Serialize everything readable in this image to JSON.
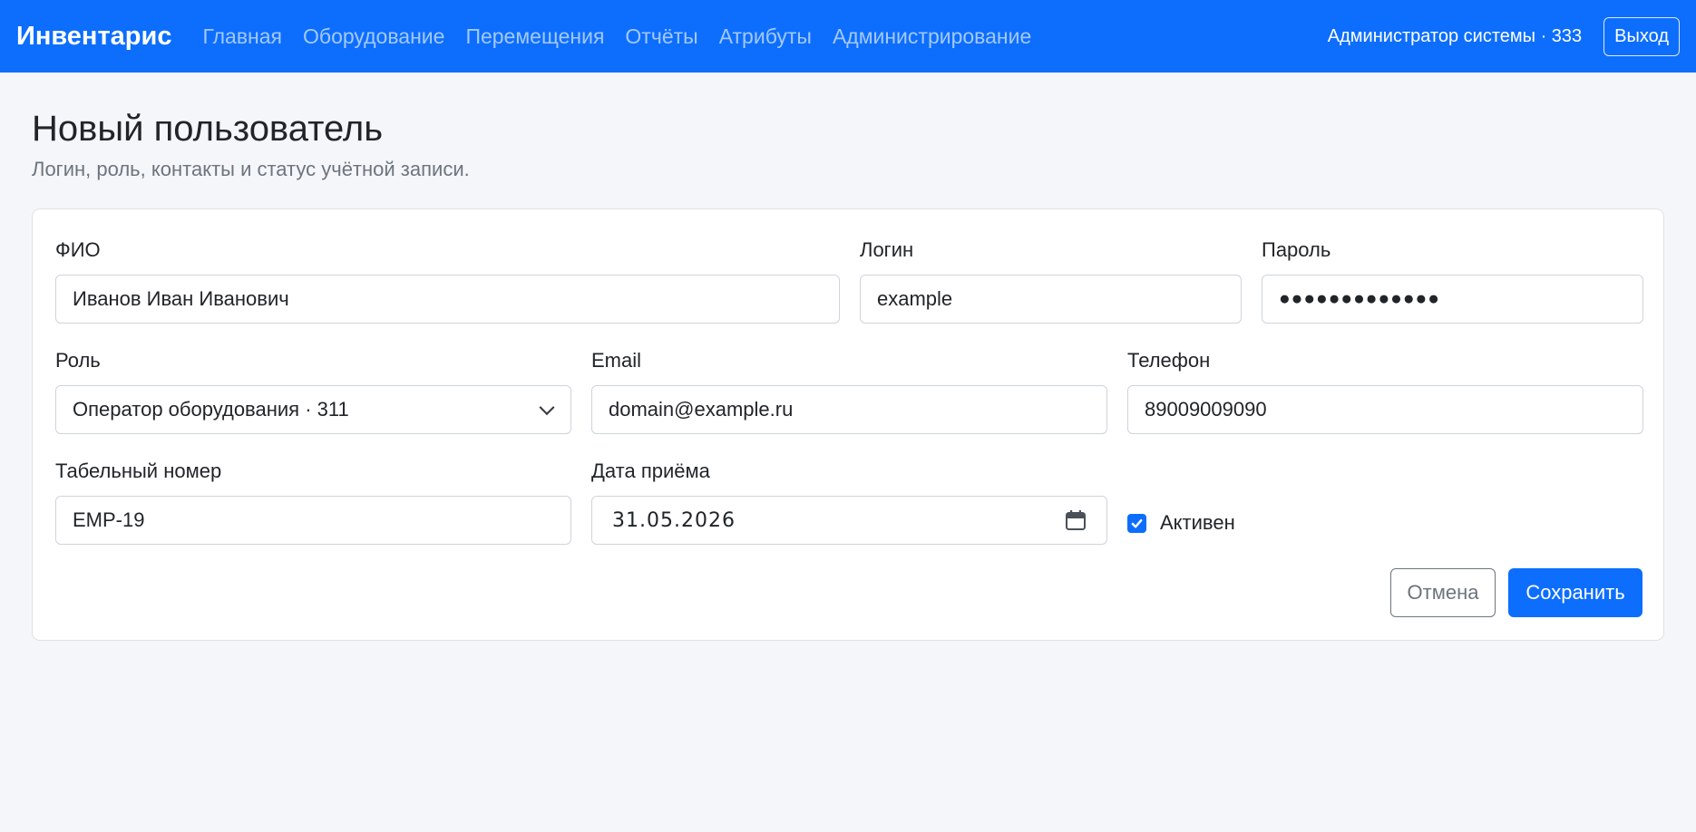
{
  "app": {
    "brand": "Инвентарис",
    "nav": [
      {
        "label": "Главная"
      },
      {
        "label": "Оборудование"
      },
      {
        "label": "Перемещения"
      },
      {
        "label": "Отчёты"
      },
      {
        "label": "Атрибуты"
      },
      {
        "label": "Администрирование"
      }
    ],
    "user": "Администратор системы · 333",
    "logout_label": "Выход"
  },
  "page": {
    "title": "Новый пользователь",
    "subtitle": "Логин, роль, контакты и статус учётной записи."
  },
  "form": {
    "full_name": {
      "label": "ФИО",
      "value": "Иванов Иван Иванович"
    },
    "login": {
      "label": "Логин",
      "value": "example"
    },
    "password": {
      "label": "Пароль",
      "value": "●●●●●●●●●●●●●"
    },
    "role": {
      "label": "Роль",
      "value": "Оператор оборудования · 311"
    },
    "email": {
      "label": "Email",
      "value": "domain@example.ru"
    },
    "phone": {
      "label": "Телефон",
      "value": "89009009090"
    },
    "employee_id": {
      "label": "Табельный номер",
      "value": "EMP-19"
    },
    "hire_date": {
      "label": "Дата приёма",
      "value": "31.05.2026"
    },
    "active": {
      "label": "Активен",
      "checked": true
    },
    "cancel_label": "Отмена",
    "save_label": "Сохранить"
  },
  "colors": {
    "primary": "#0d6efd",
    "background": "#f5f6fa",
    "muted": "#6c757d"
  },
  "icons": {
    "role_select": "chevron-down-icon",
    "hire_date": "calendar-icon",
    "active": "checkmark-icon"
  }
}
